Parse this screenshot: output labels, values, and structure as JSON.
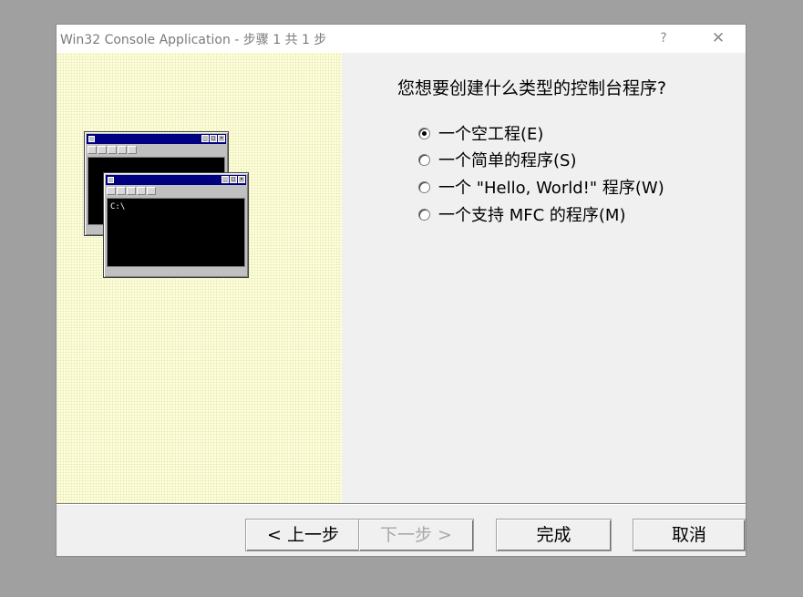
{
  "window": {
    "title": "Win32 Console Application - 步骤 1 共 1 步",
    "help_label": "?",
    "close_label": "✕"
  },
  "illustration": {
    "prompt_text": "C:\\"
  },
  "main": {
    "question": "您想要创建什么类型的控制台程序?",
    "options": [
      {
        "label": "一个空工程(E)",
        "selected": true
      },
      {
        "label": "一个简单的程序(S)",
        "selected": false
      },
      {
        "label": "一个 \"Hello, World!\" 程序(W)",
        "selected": false
      },
      {
        "label": "一个支持 MFC 的程序(M)",
        "selected": false
      }
    ]
  },
  "buttons": {
    "back": "< 上一步",
    "next": "下一步 >",
    "finish": "完成",
    "cancel": "取消"
  }
}
